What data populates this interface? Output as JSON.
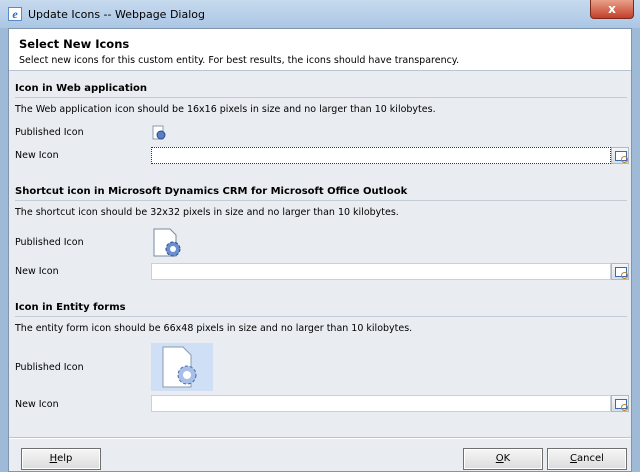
{
  "window": {
    "title": "Update Icons -- Webpage Dialog",
    "close_label": "x"
  },
  "header": {
    "title": "Select New Icons",
    "subtitle": "Select new icons for this custom entity. For best results, the icons should have transparency."
  },
  "sections": [
    {
      "title": "Icon in Web application",
      "description": "The Web application icon should be 16x16 pixels in size and no larger than 10 kilobytes.",
      "published_label": "Published Icon",
      "new_label": "New Icon",
      "new_value": ""
    },
    {
      "title": "Shortcut icon in Microsoft Dynamics CRM for Microsoft Office Outlook",
      "description": "The shortcut icon should be 32x32 pixels in size and no larger than 10 kilobytes.",
      "published_label": "Published Icon",
      "new_label": "New Icon",
      "new_value": ""
    },
    {
      "title": "Icon in Entity forms",
      "description": "The entity form icon should be 66x48 pixels in size and no larger than 10 kilobytes.",
      "published_label": "Published Icon",
      "new_label": "New Icon",
      "new_value": ""
    }
  ],
  "footer": {
    "help_first": "H",
    "help_rest": "elp",
    "ok_first": "O",
    "ok_rest": "K",
    "cancel_first": "C",
    "cancel_rest": "ancel"
  }
}
